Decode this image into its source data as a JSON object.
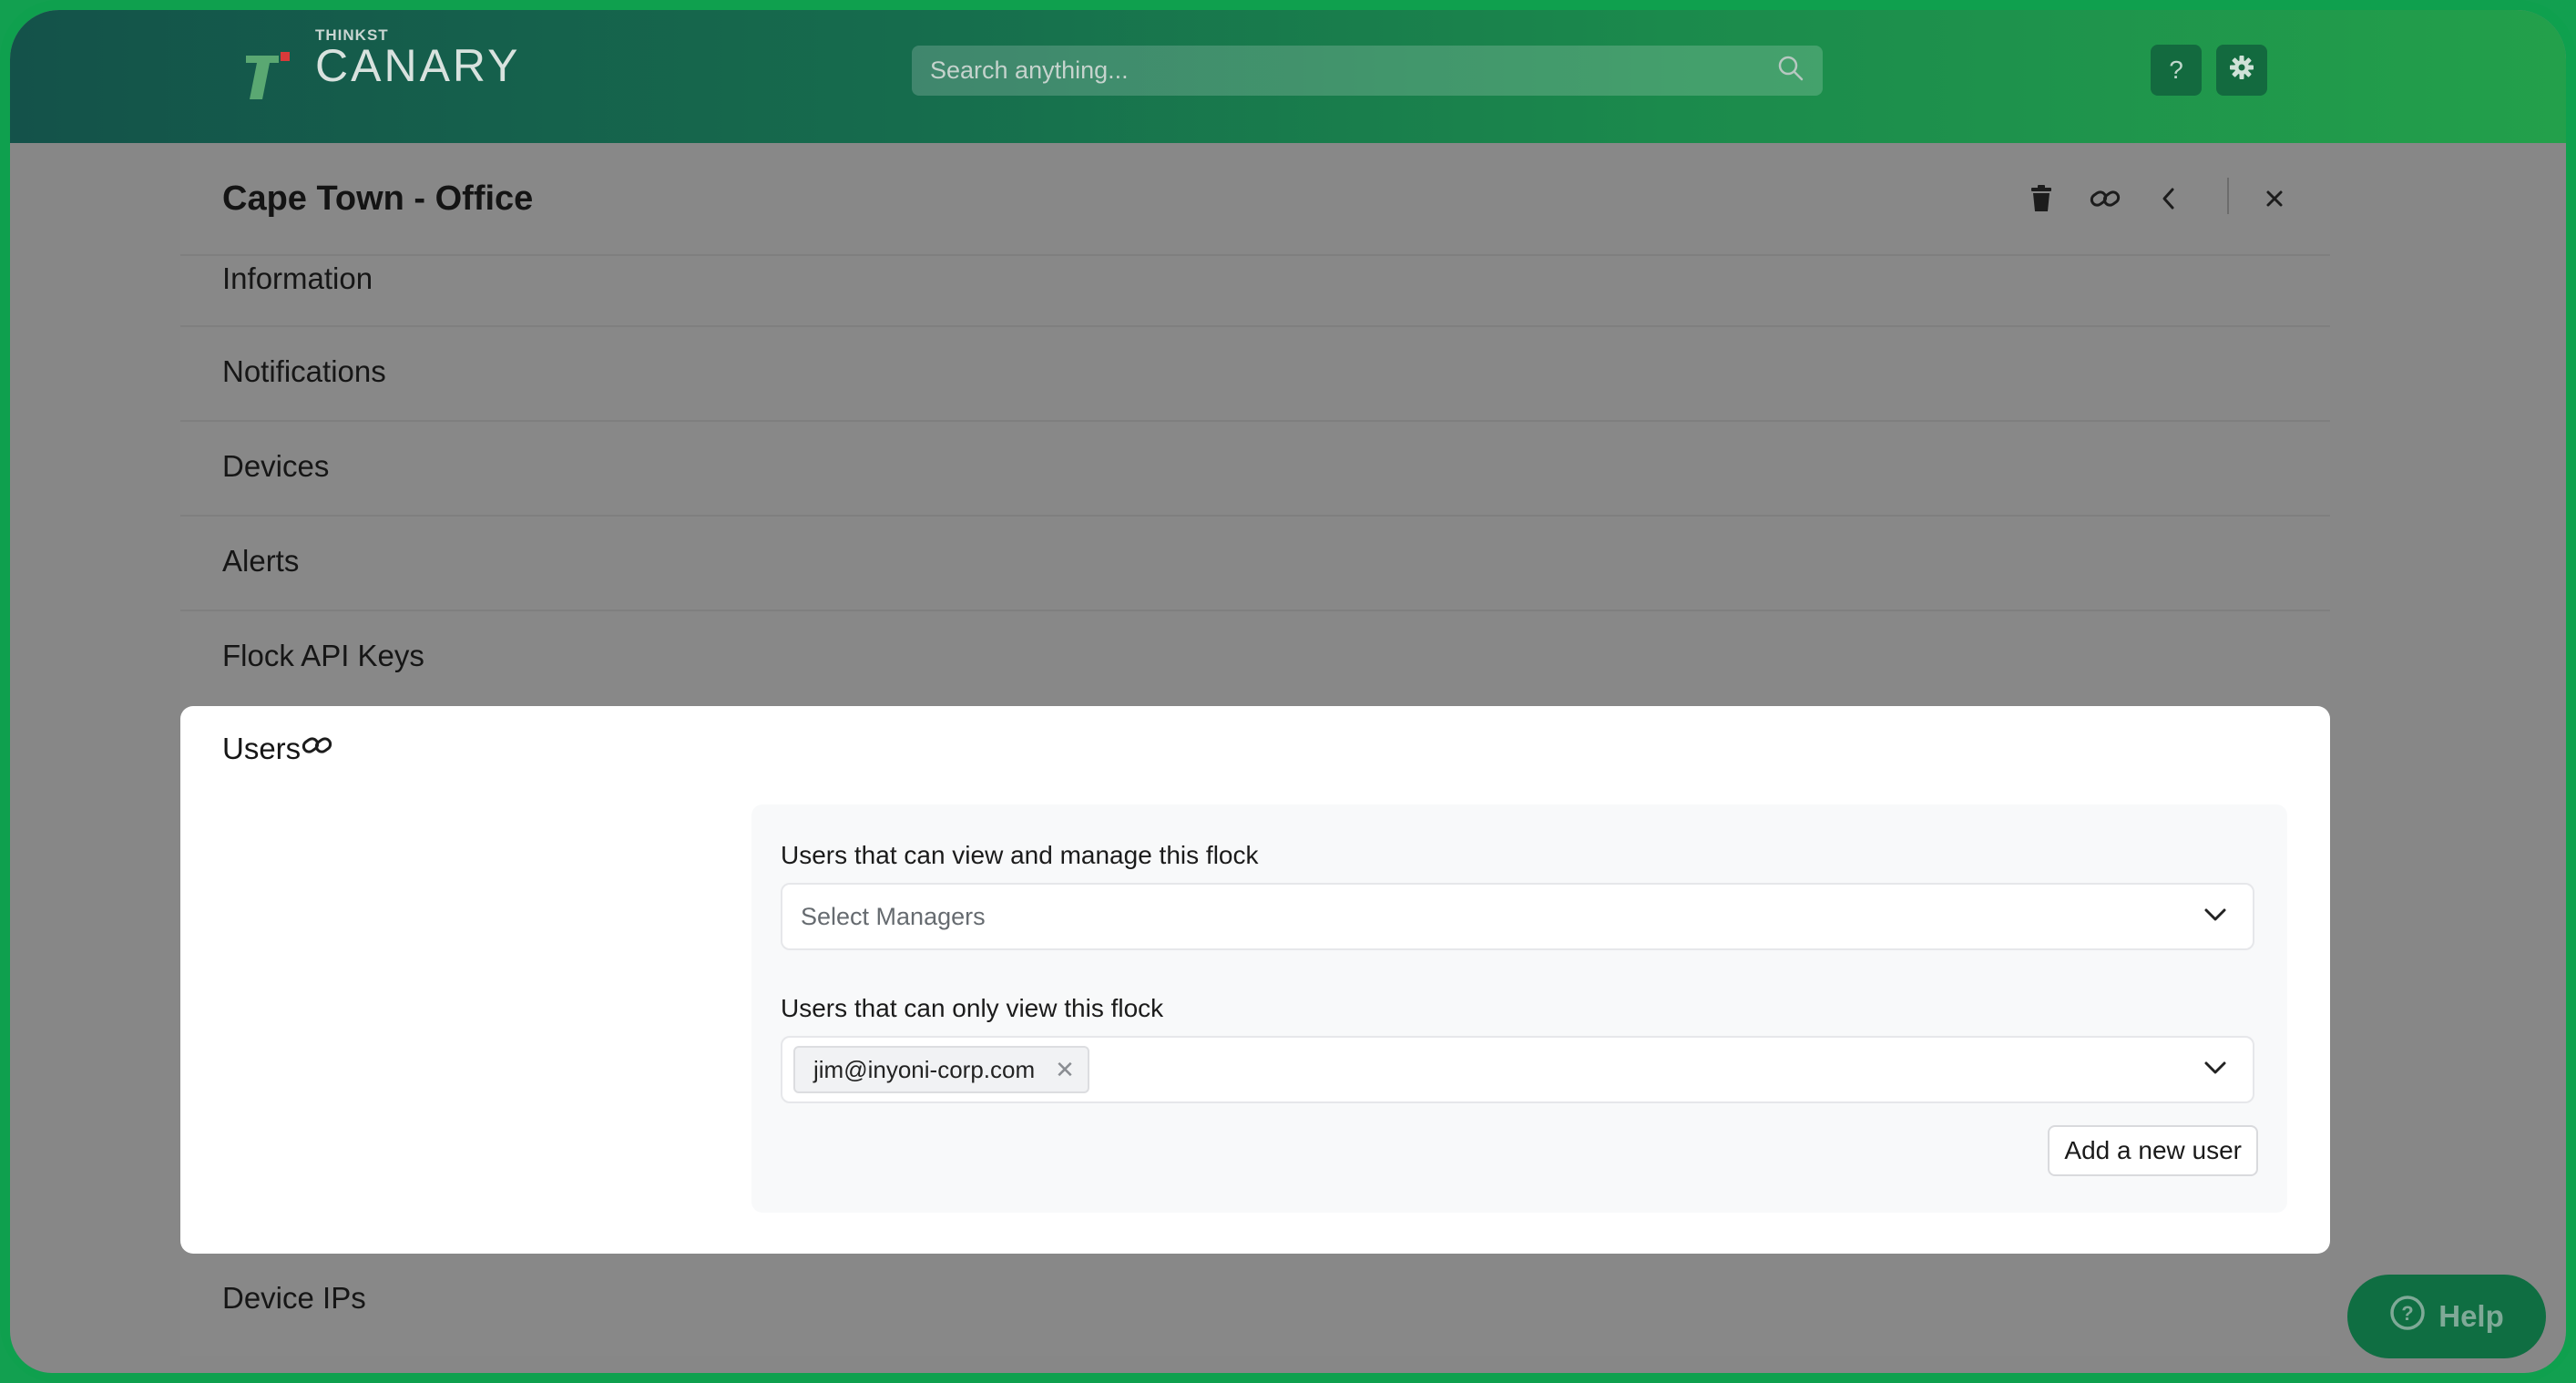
{
  "app": {
    "brand_small": "THINKST",
    "brand_big": "CANARY"
  },
  "topbar": {
    "search_placeholder": "Search anything...",
    "help_label": "?"
  },
  "panel": {
    "title": "Cape Town - Office",
    "sections": [
      {
        "label": "Information"
      },
      {
        "label": "Notifications"
      },
      {
        "label": "Devices"
      },
      {
        "label": "Alerts"
      },
      {
        "label": "Flock API Keys"
      }
    ],
    "users": {
      "title": "Users",
      "managers_label": "Users that can view and manage this flock",
      "managers_placeholder": "Select Managers",
      "viewers_label": "Users that can only view this flock",
      "viewers_selected": [
        "jim@inyoni-corp.com"
      ],
      "add_user_label": "Add a new user"
    },
    "last_section": {
      "label": "Device IPs"
    }
  },
  "help_widget": {
    "label": "Help"
  },
  "colors": {
    "accent_green": "#0fa04e",
    "topbar_start": "#14524a",
    "topbar_end": "#23a04b",
    "overlay": "#888888"
  },
  "icons": [
    "search-icon",
    "question-icon",
    "gear-icon",
    "trash-icon",
    "link-icon",
    "chevron-left-icon",
    "close-icon",
    "chevron-down-icon",
    "help-circle-icon"
  ]
}
